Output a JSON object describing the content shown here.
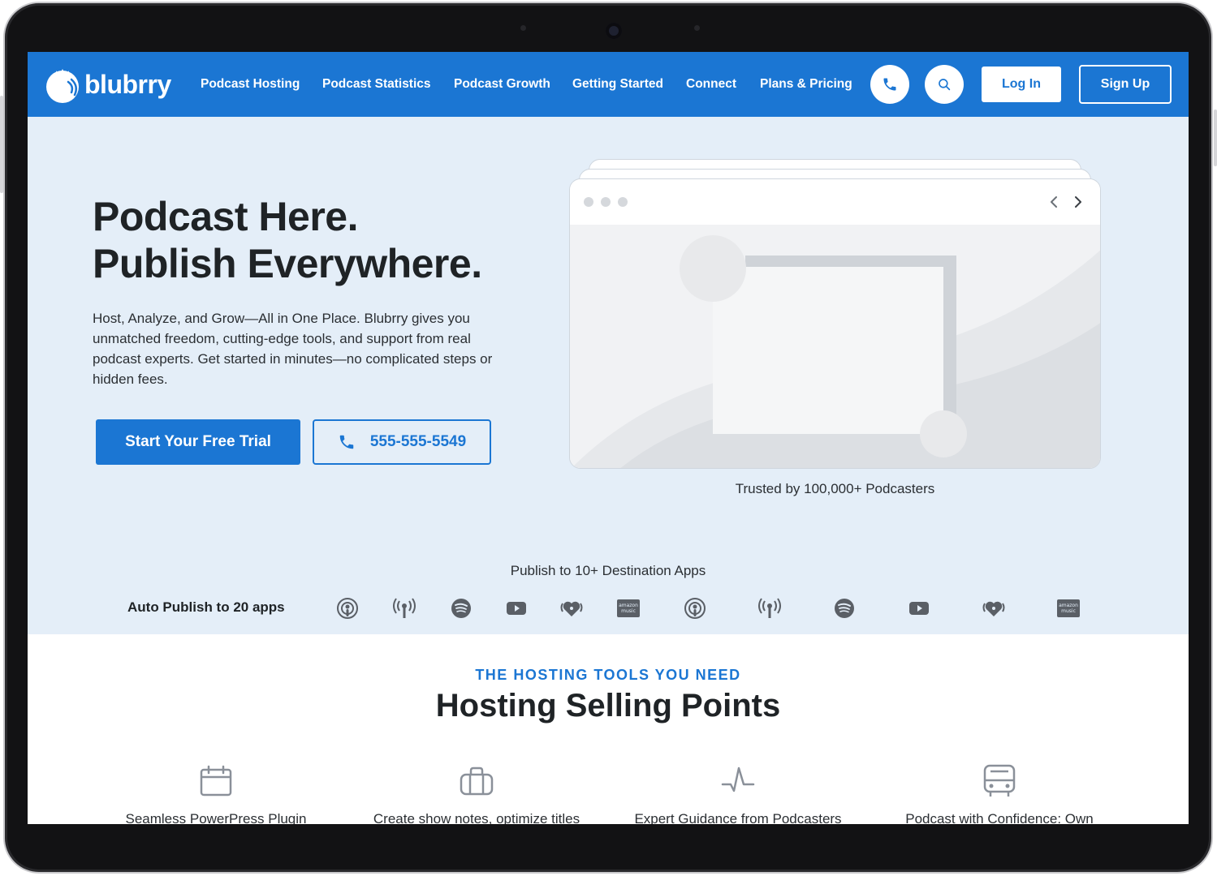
{
  "brand": {
    "name": "blubrry",
    "primary_color": "#1b76d3",
    "hero_bg": "#e4eef8"
  },
  "nav": {
    "links": [
      "Podcast Hosting",
      "Podcast Statistics",
      "Podcast Growth",
      "Getting Started",
      "Connect",
      "Plans & Pricing"
    ],
    "phone_icon": "phone-icon",
    "search_icon": "search-icon",
    "login_label": "Log In",
    "signup_label": "Sign Up"
  },
  "hero": {
    "title_line1": "Podcast Here.",
    "title_line2": "Publish Everywhere.",
    "description": "Host, Analyze, and Grow—All in One Place. Blubrry gives you unmatched freedom, cutting-edge tools, and support from real podcast experts. Get started in minutes—no complicated steps or hidden fees.",
    "cta_primary": "Start Your Free Trial",
    "cta_phone": "555-555-5549",
    "trusted": "Trusted by 100,000+ Podcasters"
  },
  "publish": {
    "title": "Publish to 10+ Destination Apps",
    "auto_label": "Auto Publish to 20 apps",
    "apps": [
      "apple-podcasts-icon",
      "podcast-antenna-icon",
      "spotify-icon",
      "youtube-icon",
      "iheart-icon",
      "amazon-music-icon",
      "apple-podcasts-icon",
      "podcast-antenna-icon",
      "spotify-icon",
      "youtube-icon",
      "iheart-icon",
      "amazon-music-icon"
    ],
    "amazon_label_1": "amazon",
    "amazon_label_2": "music"
  },
  "features_section": {
    "eyebrow": "THE HOSTING TOOLS YOU NEED",
    "title": "Hosting Selling Points",
    "items": [
      {
        "icon": "calendar-icon",
        "text": "Seamless PowerPress Plugin"
      },
      {
        "icon": "briefcase-icon",
        "text": "Create show notes, optimize titles"
      },
      {
        "icon": "activity-icon",
        "text": "Expert Guidance from Podcasters"
      },
      {
        "icon": "bus-icon",
        "text": "Podcast with Confidence: Own"
      }
    ]
  }
}
